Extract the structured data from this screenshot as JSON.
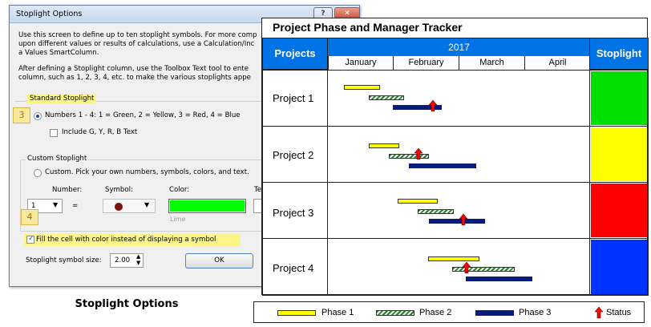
{
  "dialog": {
    "title": "Stoplight Options",
    "help_label": "?",
    "close_label": "✕",
    "para1": [
      "Use this screen to define up to ten stoplight symbols. For more comp",
      "upon different values or results of calculations, use a Calculation/Inc",
      "a Values SmartColumn."
    ],
    "para2": [
      "After defining a Stoplight column, use the Toolbox Text tool to ente",
      "column, such as 1, 2, 3, 4, etc. to make the various stoplights appe"
    ],
    "standard_heading": "Standard Stoplight",
    "callout3": "3",
    "callout4": "4",
    "numbers_option": "Numbers 1 - 4:  1 = Green, 2 = Yellow, 3 = Red, 4 = Blue",
    "include_text": "Include G, Y, R, B Text",
    "custom_group": "Custom Stoplight",
    "custom_option": "Custom.  Pick your own numbers, symbols, colors, and text.",
    "number_label": "Number:",
    "symbol_label": "Symbol:",
    "color_label": "Color:",
    "text_label": "Te",
    "number_value": "1",
    "equals": "=",
    "color_value": "#00ff00",
    "color_name": "Lime",
    "fill_option": "Fill the cell with color instead of displaying a symbol",
    "size_label": "Stoplight symbol size:",
    "size_value": "2.00",
    "ok_label": "OK"
  },
  "caption": "Stoplight Options",
  "tracker": {
    "title": "Project Phase and Manager Tracker",
    "projects_header": "Projects",
    "year": "2017",
    "stoplight_header": "Stoplight",
    "months": [
      "January",
      "February",
      "March",
      "April"
    ],
    "projects": [
      {
        "name": "Project 1",
        "stoplight": "#00e000"
      },
      {
        "name": "Project 2",
        "stoplight": "#ffff00"
      },
      {
        "name": "Project 3",
        "stoplight": "#ff0000"
      },
      {
        "name": "Project 4",
        "stoplight": "#0033ff"
      }
    ],
    "legend": {
      "phase1": "Phase 1",
      "phase2": "Phase 2",
      "phase3": "Phase 3",
      "status": "Status"
    },
    "colors": {
      "header_blue": "#0073e6",
      "phase1": "#ffff00",
      "phase3": "#0a1b7a",
      "status": "#ff0000"
    }
  }
}
